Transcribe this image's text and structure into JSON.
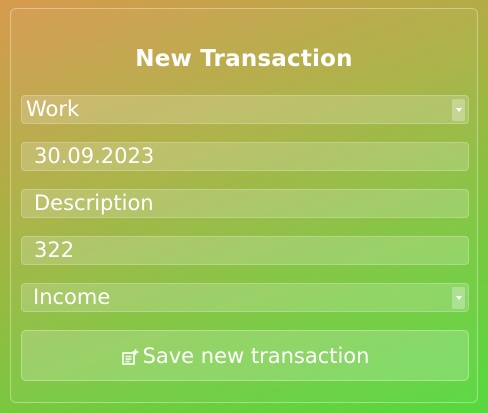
{
  "form": {
    "title": "New Transaction",
    "category_select": {
      "value": "Work"
    },
    "date_field": {
      "value": "30.09.2023"
    },
    "description_field": {
      "value": "Description"
    },
    "amount_field": {
      "value": "322"
    },
    "type_select": {
      "value": "Income"
    },
    "save_button": {
      "label": "Save new transaction",
      "icon": "note-add-icon"
    }
  },
  "colors": {
    "background_start": "#d79a4f",
    "background_end": "#56d93f",
    "text": "#ffffff"
  }
}
